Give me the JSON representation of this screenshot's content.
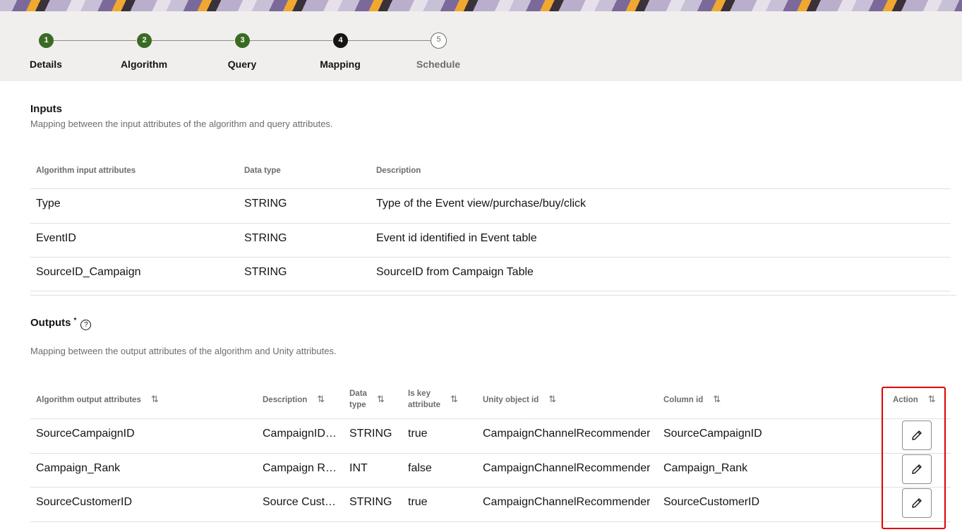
{
  "stepper": {
    "steps": [
      {
        "number": "1",
        "label": "Details",
        "state": "complete"
      },
      {
        "number": "2",
        "label": "Algorithm",
        "state": "complete"
      },
      {
        "number": "3",
        "label": "Query",
        "state": "complete"
      },
      {
        "number": "4",
        "label": "Mapping",
        "state": "current"
      },
      {
        "number": "5",
        "label": "Schedule",
        "state": "upcoming"
      }
    ],
    "colors": {
      "complete": "#3a6b25",
      "current": "#161513",
      "upcoming": "#6f6c69"
    }
  },
  "inputs": {
    "title": "Inputs",
    "subtitle": "Mapping between the input attributes of the algorithm and query attributes.",
    "headers": {
      "attribute": "Algorithm input attributes",
      "data_type": "Data type",
      "description": "Description"
    },
    "rows": [
      {
        "attribute": "Type",
        "data_type": "STRING",
        "description": "Type of the Event view/purchase/buy/click"
      },
      {
        "attribute": "EventID",
        "data_type": "STRING",
        "description": "Event id identified in Event table"
      },
      {
        "attribute": "SourceID_Campaign",
        "data_type": "STRING",
        "description": "SourceID from Campaign Table"
      }
    ]
  },
  "outputs": {
    "title": "Outputs",
    "required_mark": "*",
    "help_icon": "question-circle-icon",
    "subtitle": "Mapping between the output attributes of the algorithm and Unity attributes.",
    "headers": {
      "attribute": "Algorithm output attributes",
      "description": "Description",
      "data_type_1": "Data",
      "data_type_2": "type",
      "is_key_1": "Is key",
      "is_key_2": "attribute",
      "unity_object_id": "Unity object id",
      "column_id": "Column id",
      "action": "Action"
    },
    "sort_icon": "⇅",
    "rows": [
      {
        "attribute": "SourceCampaignID",
        "description": "CampaignID…",
        "data_type": "STRING",
        "is_key": "true",
        "unity_object_id": "CampaignChannelRecommender",
        "column_id": "SourceCampaignID",
        "action_icon": "pencil-icon"
      },
      {
        "attribute": "Campaign_Rank",
        "description": "Campaign R…",
        "data_type": "INT",
        "is_key": "false",
        "unity_object_id": "CampaignChannelRecommender",
        "column_id": "Campaign_Rank",
        "action_icon": "pencil-icon"
      },
      {
        "attribute": "SourceCustomerID",
        "description": "Source Cust…",
        "data_type": "STRING",
        "is_key": "true",
        "unity_object_id": "CampaignChannelRecommender",
        "column_id": "SourceCustomerID",
        "action_icon": "pencil-icon"
      }
    ]
  },
  "highlight_color": "#e00000"
}
